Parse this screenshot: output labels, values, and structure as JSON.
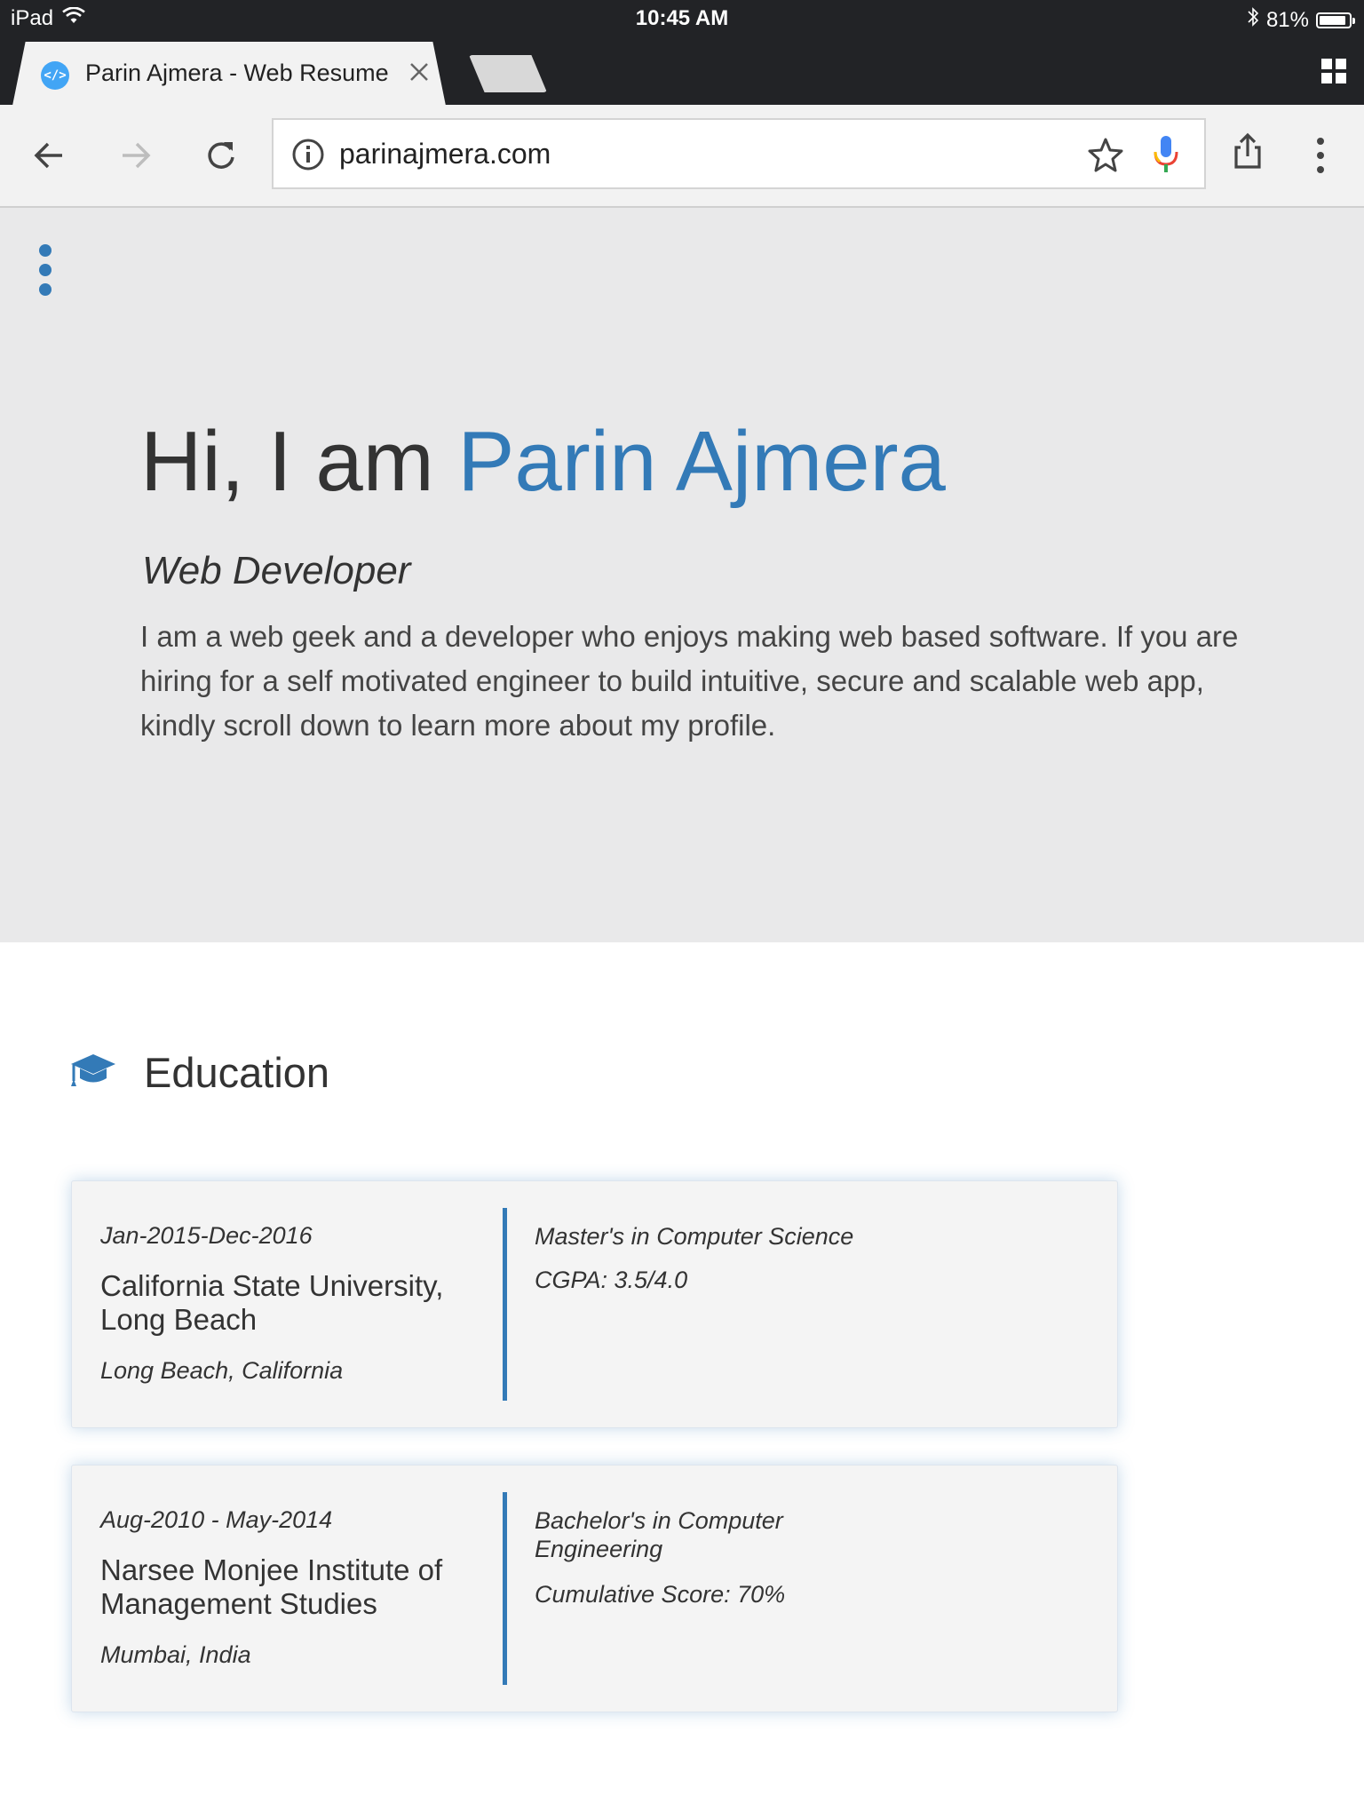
{
  "status_bar": {
    "device": "iPad",
    "time": "10:45 AM",
    "battery": "81%",
    "battery_level": 0.81
  },
  "browser": {
    "tab_title": "Parin Ajmera - Web Resume",
    "url": "parinajmera.com",
    "favicon_text": "</>"
  },
  "hero": {
    "greeting": "Hi, I am ",
    "name": "Parin Ajmera",
    "role": "Web Developer",
    "intro": "I am a web geek and a developer who enjoys making web based software. If you are hiring for a self motivated engineer to build intuitive, secure and scalable web app, kindly scroll down to learn more about my profile."
  },
  "education": {
    "title": "Education",
    "entries": [
      {
        "dates": "Jan-2015-Dec-2016",
        "school": "California State University, Long Beach",
        "location": "Long Beach, California",
        "degree": "Master's in Computer Science",
        "score": "CGPA: 3.5/4.0"
      },
      {
        "dates": "Aug-2010 - May-2014",
        "school": "Narsee Monjee Institute of Management Studies",
        "location": "Mumbai, India",
        "degree": "Bachelor's in Computer Engineering",
        "score": "Cumulative Score: 70%"
      }
    ]
  },
  "colors": {
    "accent": "#337ab7",
    "hero_bg": "#e9e9ea",
    "chrome_dark": "#222326",
    "mic_blue": "#4285f4",
    "mic_red": "#ea4335"
  }
}
